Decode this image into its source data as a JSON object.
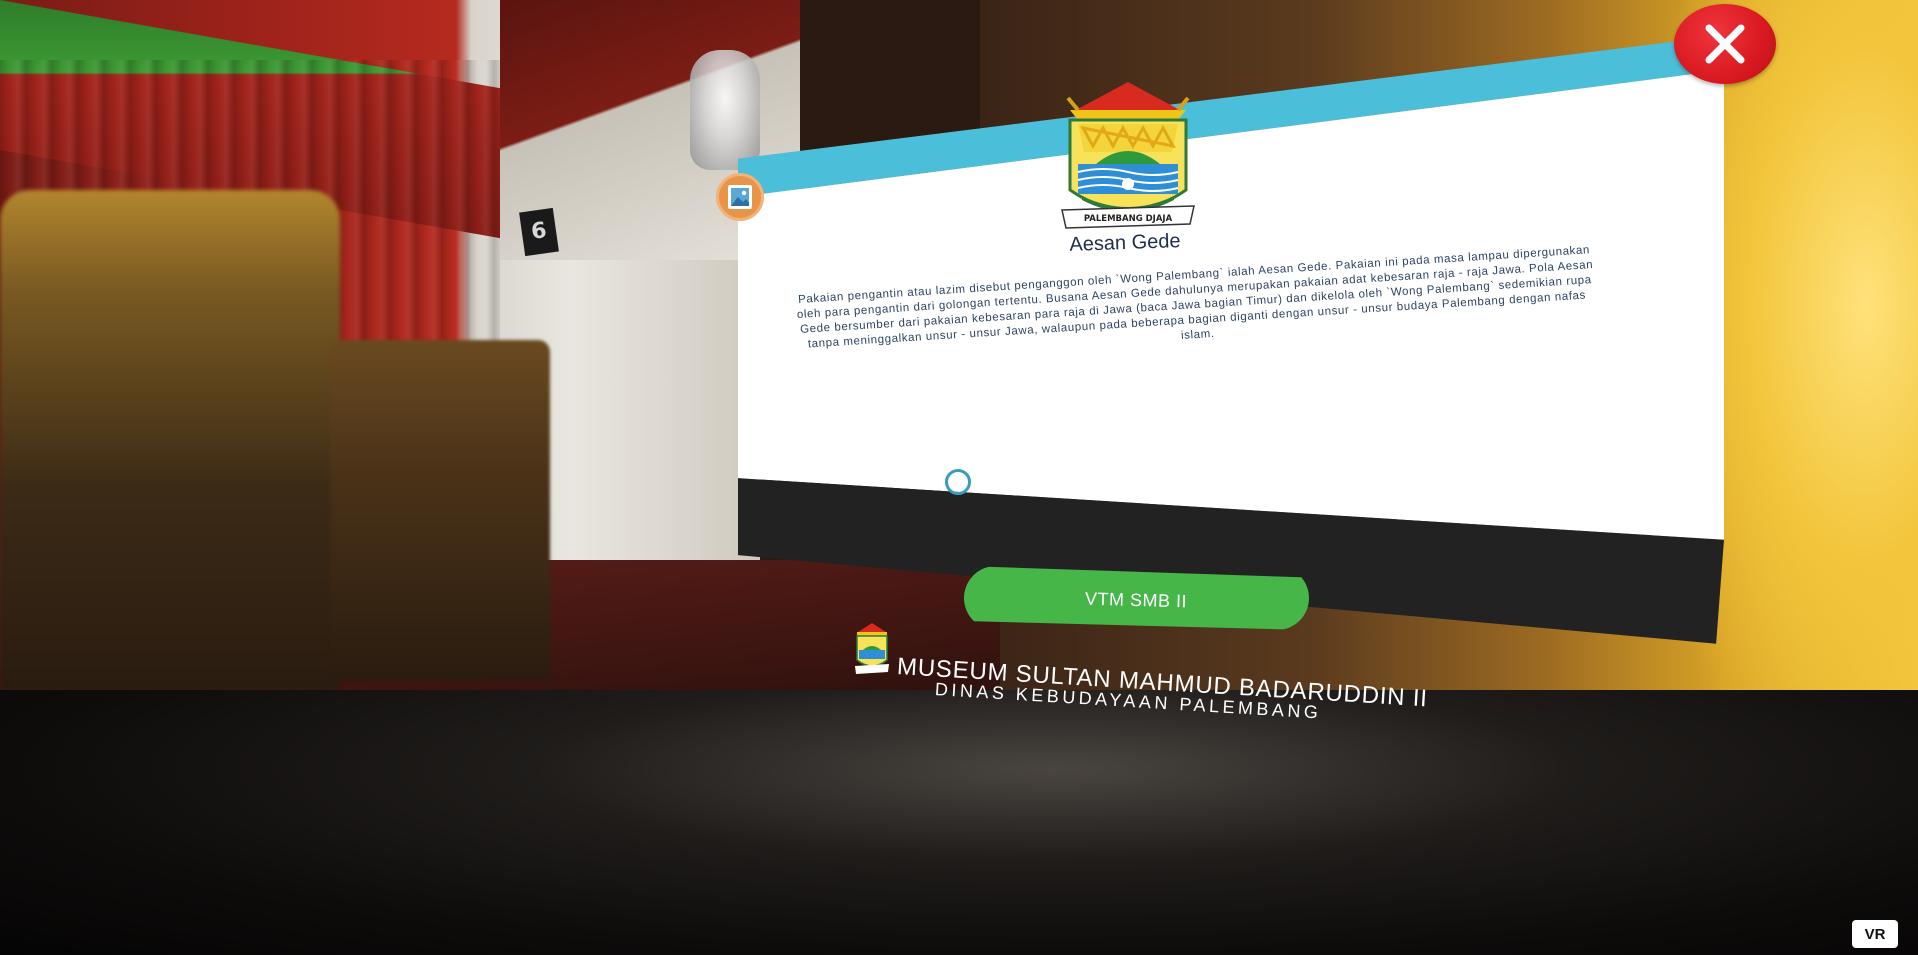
{
  "scene": {
    "sign_number": "6"
  },
  "panel": {
    "emblem_ribbon": "PALEMBANG DJAJA",
    "title": "Aesan Gede",
    "description": "Pakaian pengantin atau lazim disebut penganggon oleh `Wong Palembang` ialah Aesan Gede. Pakaian ini pada masa lampau dipergunakan oleh para pengantin dari golongan tertentu. Busana Aesan Gede dahulunya merupakan pakaian adat kebesaran raja - raja Jawa. Pola Aesan Gede bersumber dari pakaian kebesaran para raja di Jawa (baca Jawa bagian Timur) dan dikelola oleh `Wong Palembang` sedemikian rupa tanpa meninggalkan unsur - unsur Jawa, walaupun pada beberapa bagian diganti dengan unsur - unsur budaya Palembang dengan nafas islam.",
    "action_button": "VTM SMB II",
    "footer_museum": "MUSEUM SULTAN MAHMUD BADARUDDIN II",
    "footer_department": "DINAS KEBUDAYAAN PALEMBANG"
  },
  "controls": {
    "close_icon": "close-icon",
    "gallery_icon": "image-icon",
    "vr_label": "VR"
  },
  "colors": {
    "panel_accent": "#4bbfd9",
    "panel_footer": "#222222",
    "action_green": "#46b649",
    "close_red": "#d91920",
    "gallery_orange": "#e8954a"
  }
}
